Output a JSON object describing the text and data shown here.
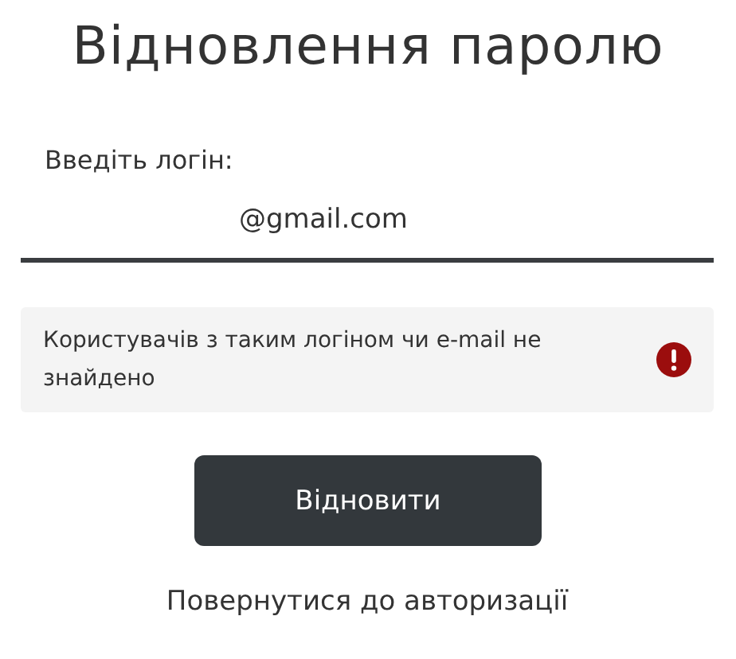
{
  "title": "Відновлення паролю",
  "login_field": {
    "label": "Введіть логін:",
    "value": "@gmail.com"
  },
  "error": {
    "message": "Користувачів з таким логіном чи e-mail не знайдено"
  },
  "submit_button": "Відновити",
  "back_link": "Повернутися до авторизації"
}
